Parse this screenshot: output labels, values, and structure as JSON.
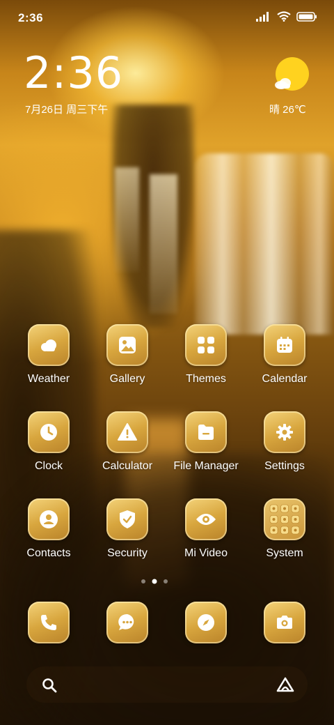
{
  "status_bar": {
    "time": "2:36"
  },
  "lockclock": {
    "time": "2:36",
    "date": "7月26日 周三下午"
  },
  "weather_widget": {
    "text": "晴 26℃",
    "icon": "sun-cloud-icon"
  },
  "apps": [
    {
      "label": "Weather",
      "icon": "weather-cloud-icon"
    },
    {
      "label": "Gallery",
      "icon": "image-icon"
    },
    {
      "label": "Themes",
      "icon": "grid-icon"
    },
    {
      "label": "Calendar",
      "icon": "calendar-icon"
    },
    {
      "label": "Clock",
      "icon": "clock-icon"
    },
    {
      "label": "Calculator",
      "icon": "warning-icon"
    },
    {
      "label": "File Manager",
      "icon": "folder-icon"
    },
    {
      "label": "Settings",
      "icon": "gear-icon"
    },
    {
      "label": "Contacts",
      "icon": "person-icon"
    },
    {
      "label": "Security",
      "icon": "shield-check-icon"
    },
    {
      "label": "Mi Video",
      "icon": "eye-icon"
    },
    {
      "label": "System",
      "icon": "folder-grid-icon"
    }
  ],
  "dock": [
    {
      "icon": "phone-icon"
    },
    {
      "icon": "message-icon"
    },
    {
      "icon": "compass-icon"
    },
    {
      "icon": "camera-icon"
    }
  ],
  "page_indicator": {
    "pages": 3,
    "current": 2
  },
  "colors": {
    "tile_light": "#f4d37a",
    "tile_dark": "#b9832a",
    "glyph": "#ffffff",
    "sun": "#ffd21f"
  }
}
